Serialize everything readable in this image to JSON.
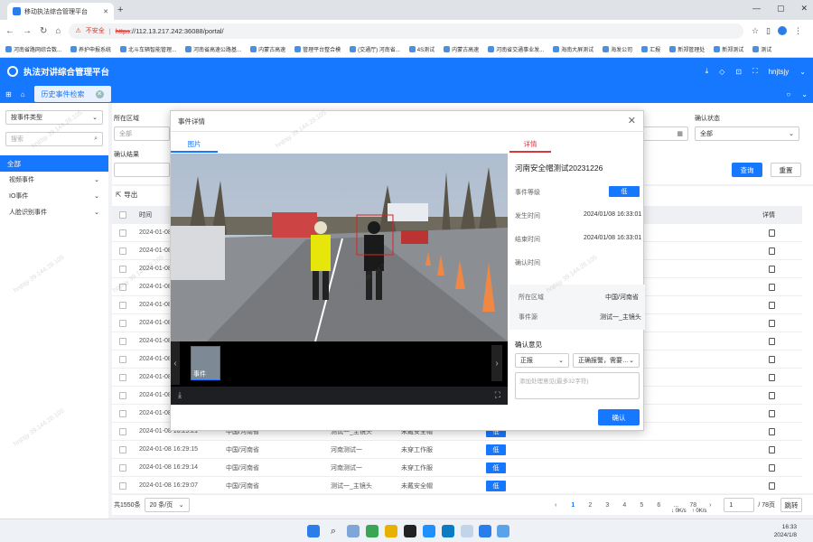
{
  "browser": {
    "tab_title": "移动执法综合管理平台",
    "url_warning": "不安全",
    "url_scheme": "https",
    "url_rest": "://112.13.217.242:36088/portal/",
    "bookmarks": [
      "河南省路网综合数...",
      "养护申报系统",
      "北斗车辆智能管理...",
      "河南省高速公路基...",
      "内蒙古高速",
      "管理平台整合模",
      "(交通厅) 河南省...",
      "4S测试",
      "内蒙古高速",
      "河南省交通事业发...",
      "海南大屏测试",
      "海发公司",
      "汇报",
      "新郑管理处",
      "新郑测试",
      "测试"
    ]
  },
  "app": {
    "title": "执法对讲综合管理平台",
    "user": "hnjtsjy",
    "tab_label": "历史事件检索"
  },
  "sidebar": {
    "type_select": "按事件类型",
    "search_placeholder": "搜索",
    "all": "全部",
    "items": [
      "视频事件",
      "IO事件",
      "人脸识别事件"
    ]
  },
  "filters": {
    "region_label": "所在区域",
    "region_value": "全部",
    "confirm_result_label": "确认结果",
    "confirm_status_label": "确认状态",
    "confirm_status_value": "全部",
    "query": "查询",
    "reset": "重置",
    "export": "导出"
  },
  "table": {
    "col_time": "时间",
    "col_detail": "详情",
    "level": "低",
    "bg_rows": [
      "2024-01-08",
      "2024-01-08",
      "2024-01-08",
      "2024-01-08",
      "2024-01-08",
      "2024-01-08",
      "2024-01-08",
      "2024-01-08",
      "2024-01-08",
      "2024-01-08",
      "2024-01-08"
    ],
    "rows": [
      {
        "time": "2024-01-08 16:29:21",
        "region": "中国/河南省",
        "source": "测试一_主镜头",
        "type": "未戴安全帽"
      },
      {
        "time": "2024-01-08 16:29:15",
        "region": "中国/河南省",
        "source": "河南测试一",
        "type": "未穿工作服"
      },
      {
        "time": "2024-01-08 16:29:14",
        "region": "中国/河南省",
        "source": "河南测试一",
        "type": "未穿工作服"
      },
      {
        "time": "2024-01-08 16:29:07",
        "region": "中国/河南省",
        "source": "测试一_主镜头",
        "type": "未戴安全帽"
      }
    ]
  },
  "pager": {
    "total": "共1550条",
    "page_size": "20 条/页",
    "pages": [
      "1",
      "2",
      "3",
      "4",
      "5",
      "6",
      "...",
      "78"
    ],
    "jump_value": "1",
    "total_pages": "/ 78页",
    "jump": "跳转"
  },
  "modal": {
    "title": "事件详情",
    "tab_photo": "图片",
    "tab_detail": "详情",
    "thumb_label": "事件",
    "event_name": "河南安全帽测试20231226",
    "level_label": "事件等级",
    "level_value": "低",
    "start_label": "发生时间",
    "start_value": "2024/01/08 16:33:01",
    "end_label": "结束时间",
    "end_value": "2024/01/08 16:33:01",
    "confirm_time_label": "确认时间",
    "region_label": "所在区域",
    "region_value": "中国/河南省",
    "source_label": "事件源",
    "source_value": "测试一_主镜头",
    "opinion_label": "确认意见",
    "opinion_select1": "正报",
    "opinion_select2": "正确报警，需要及时...",
    "opinion_placeholder": "添加处理意见(最多32字符)",
    "confirm_button": "确认"
  },
  "taskbar": {
    "net_up": "0K/s",
    "net_down": "0K/s",
    "time": "16:33",
    "date": "2024/1/8"
  },
  "watermark": "hnjtsjy 39.144.28.105"
}
